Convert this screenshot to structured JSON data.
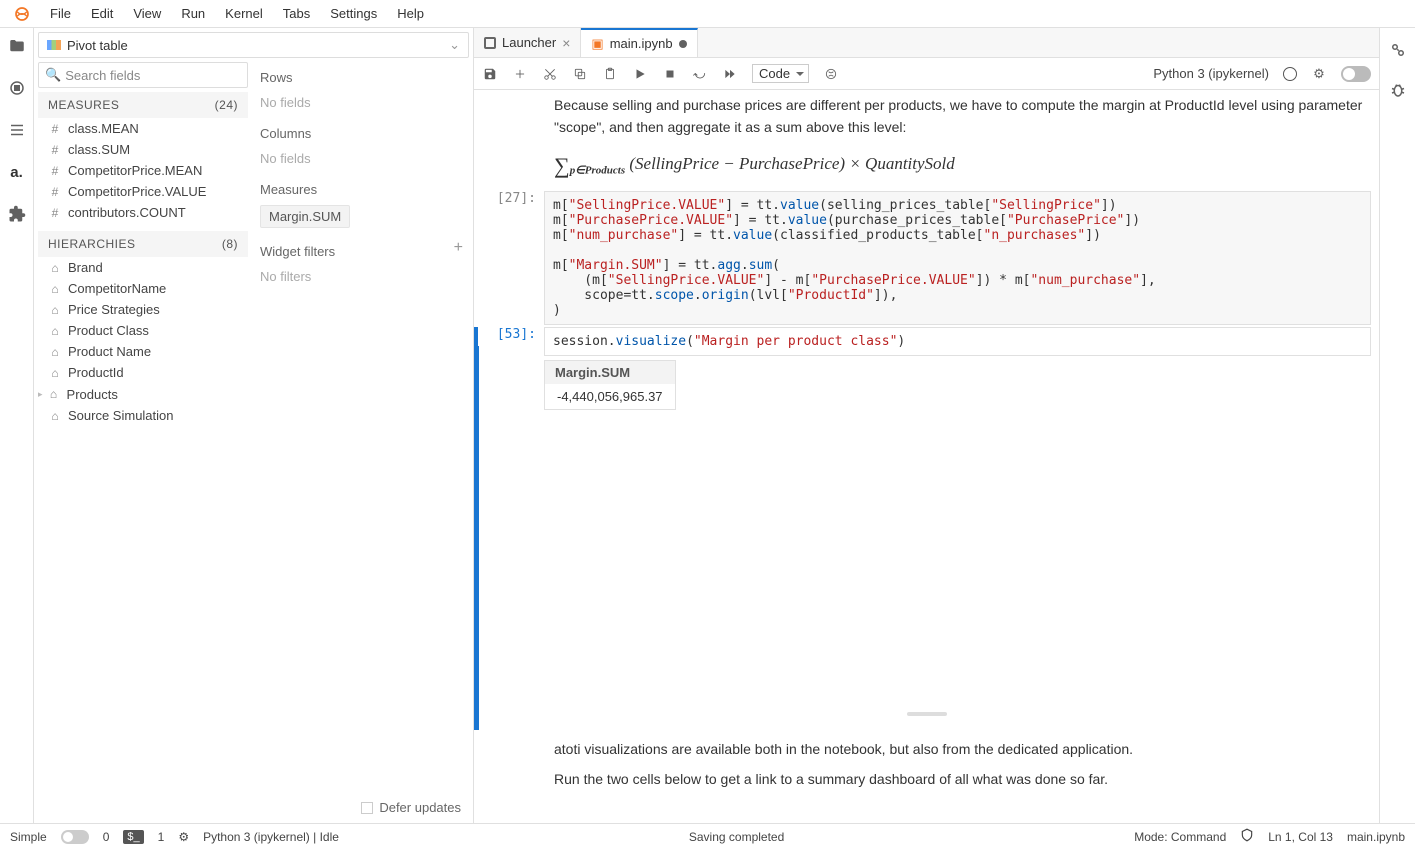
{
  "menu": {
    "items": [
      "File",
      "Edit",
      "View",
      "Run",
      "Kernel",
      "Tabs",
      "Settings",
      "Help"
    ]
  },
  "pivot": {
    "title": "Pivot table",
    "search_placeholder": "Search fields",
    "measures_header": "MEASURES",
    "measures_count": "(24)",
    "measures": [
      "class.MEAN",
      "class.SUM",
      "CompetitorPrice.MEAN",
      "CompetitorPrice.VALUE",
      "contributors.COUNT"
    ],
    "hier_header": "HIERARCHIES",
    "hier_count": "(8)",
    "hierarchies": [
      "Brand",
      "CompetitorName",
      "Price Strategies",
      "Product Class",
      "Product Name",
      "ProductId",
      "Products",
      "Source Simulation"
    ],
    "rows_label": "Rows",
    "rows_empty": "No fields",
    "cols_label": "Columns",
    "cols_empty": "No fields",
    "meas_label": "Measures",
    "meas_chip": "Margin.SUM",
    "filt_label": "Widget filters",
    "filt_empty": "No filters",
    "defer": "Defer updates"
  },
  "tabs": {
    "launcher": "Launcher",
    "main": "main.ipynb"
  },
  "toolbar": {
    "celltype": "Code",
    "kernel": "Python 3 (ipykernel)"
  },
  "notebook": {
    "md1": "Because selling and purchase prices are different per products, we have to compute the margin at ProductId level using parameter \"scope\", and then aggregate it as a sum above this level:",
    "prompt27": "[27]:",
    "prompt53": "[53]:",
    "out_header": "Margin.SUM",
    "out_value": "-4,440,056,965.37",
    "md2": "atoti visualizations are available both in the notebook, but also from the dedicated application.",
    "md3": "Run the two cells below to get a link to a summary dashboard of all what was done so far."
  },
  "status": {
    "simple": "Simple",
    "zero": "0",
    "one": "1",
    "kernel": "Python 3 (ipykernel) | Idle",
    "saving": "Saving completed",
    "mode": "Mode: Command",
    "lncol": "Ln 1, Col 13",
    "file": "main.ipynb"
  }
}
